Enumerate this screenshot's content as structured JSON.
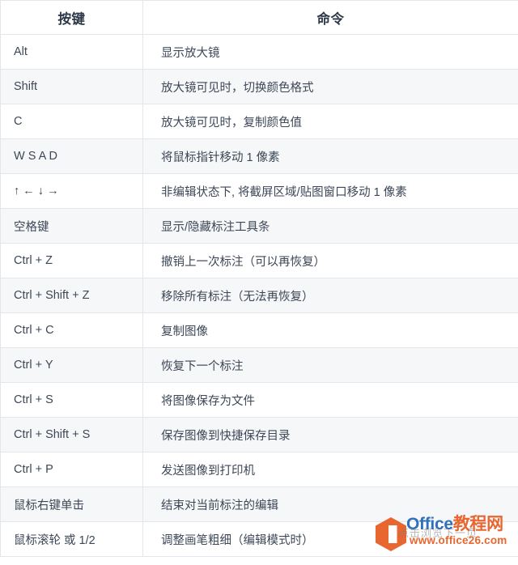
{
  "table": {
    "headers": {
      "key": "按键",
      "command": "命令"
    },
    "rows": [
      {
        "key": "Alt",
        "command": "显示放大镜"
      },
      {
        "key": "Shift",
        "command": "放大镜可见时，切换颜色格式"
      },
      {
        "key": "C",
        "command": "放大镜可见时，复制颜色值"
      },
      {
        "key": "W S A D",
        "command": "将鼠标指针移动 1 像素"
      },
      {
        "key": "↑ ← ↓ →",
        "command": "非编辑状态下, 将截屏区域/贴图窗口移动 1 像素"
      },
      {
        "key": "空格键",
        "command": "显示/隐藏标注工具条"
      },
      {
        "key": "Ctrl + Z",
        "command": "撤销上一次标注（可以再恢复）"
      },
      {
        "key": "Ctrl + Shift + Z",
        "command": "移除所有标注（无法再恢复）"
      },
      {
        "key": "Ctrl + C",
        "command": "复制图像"
      },
      {
        "key": "Ctrl + Y",
        "command": "恢复下一个标注"
      },
      {
        "key": "Ctrl + S",
        "command": "将图像保存为文件"
      },
      {
        "key": "Ctrl + Shift + S",
        "command": "保存图像到快捷保存目录"
      },
      {
        "key": "Ctrl + P",
        "command": "发送图像到打印机"
      },
      {
        "key": "鼠标右键单击",
        "command": "结束对当前标注的编辑"
      },
      {
        "key": "鼠标滚轮 或 1/2",
        "command": "调整画笔粗细（编辑模式时）"
      }
    ]
  },
  "watermark": {
    "brand_prefix": "Office",
    "brand_suffix": "教程网",
    "url": "www.office26.com",
    "ghost_text": "点击浏览下一页",
    "logo_color": "#e8622a",
    "brand_color_blue": "#2b6cb8",
    "brand_color_orange": "#e8622a"
  },
  "style": {
    "text_color": "#3d4757",
    "header_color": "#2d3748",
    "border_color": "#e3e6ea",
    "stripe_color": "#f6f7f8"
  }
}
